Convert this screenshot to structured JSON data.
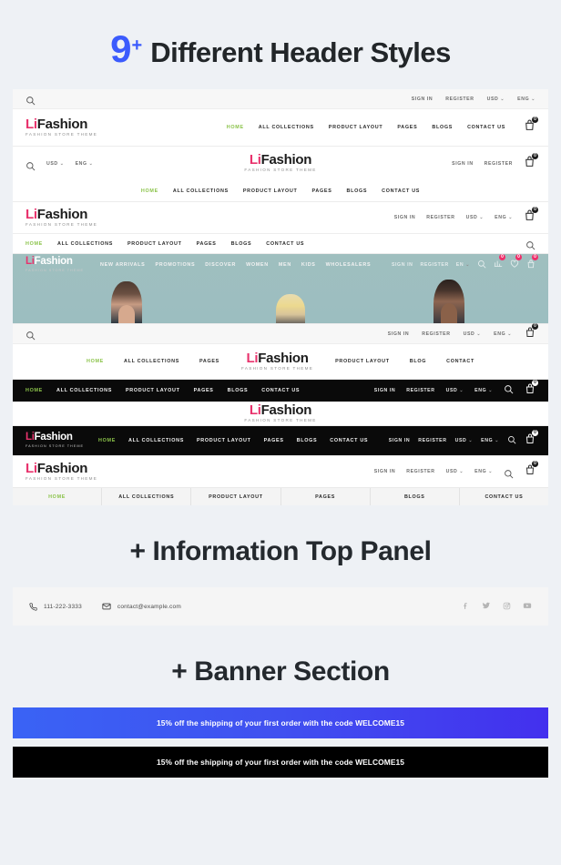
{
  "page": {
    "title_count": "9",
    "title_plus": "+",
    "title_rest": "Different Header Styles",
    "info_title": "+ Information  Top Panel",
    "banner_title": "+ Banner Section",
    "accent_blue": "#3b5bfd",
    "accent_pink": "#e8336d",
    "accent_green": "#8bc34a",
    "background": "#eef1f5"
  },
  "brand": {
    "logo_li": "Li",
    "logo_fashion": "Fashion",
    "tagline": "FASHION STORE THEME"
  },
  "utility": {
    "sign_in": "SIGN IN",
    "register": "REGISTER",
    "currency": "USD",
    "language": "ENG",
    "language_short": "EN",
    "caret": "⌄",
    "cart_count": "0"
  },
  "nav_main": [
    {
      "label": "HOME",
      "active": true
    },
    {
      "label": "ALL COLLECTIONS",
      "active": false
    },
    {
      "label": "PRODUCT LAYOUT",
      "active": false
    },
    {
      "label": "PAGES",
      "active": false
    },
    {
      "label": "BLOGS",
      "active": false
    },
    {
      "label": "CONTACT US",
      "active": false
    }
  ],
  "headers": [
    {
      "id": "header-1",
      "style": "top-utility-bar-logo-left-nav-right"
    },
    {
      "id": "header-2",
      "style": "centered-logo-nav-below"
    },
    {
      "id": "header-3",
      "style": "logo-left-nav-row-with-search"
    },
    {
      "id": "header-4",
      "style": "transparent-overlay-on-hero",
      "nav": [
        "NEW ARRIVALS",
        "PROMOTIONS",
        "DISCOVER",
        "WOMEN",
        "MEN",
        "KIDS",
        "WHOLESALERS"
      ],
      "compare_count": "0",
      "wishlist_count": "0",
      "cart_count": "0"
    },
    {
      "id": "header-5",
      "style": "split-nav-centered-logo",
      "nav_left": [
        "HOME",
        "ALL COLLECTIONS",
        "PAGES"
      ],
      "nav_right": [
        "PRODUCT LAYOUT",
        "BLOG",
        "CONTACT"
      ]
    },
    {
      "id": "header-6",
      "style": "black-nav-bar-logo-below"
    },
    {
      "id": "header-7",
      "style": "all-black-bar-logo-left"
    },
    {
      "id": "header-8",
      "style": "logo-top-divided-nav-strip"
    }
  ],
  "info_panel": {
    "phone": "111-222-3333",
    "email": "contact@example.com",
    "socials": [
      "facebook-icon",
      "twitter-icon",
      "instagram-icon",
      "youtube-icon"
    ]
  },
  "banners": [
    {
      "text": "15% off the shipping of your first order with the code WELCOME15",
      "style": "blue-gradient"
    },
    {
      "text": "15% off the shipping of your first order with the code WELCOME15",
      "style": "black"
    }
  ],
  "icons": {
    "search": "search-icon",
    "cart": "shopping-bag-icon",
    "phone": "phone-icon",
    "mail": "mail-icon",
    "heart": "heart-icon",
    "compare": "compare-icon"
  }
}
